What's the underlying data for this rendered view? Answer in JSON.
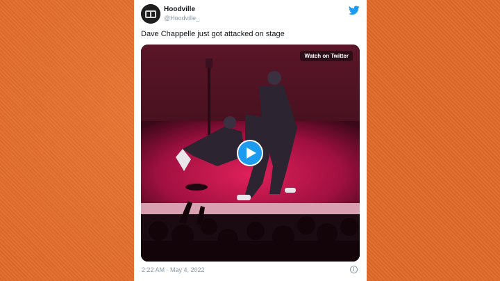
{
  "tweet": {
    "author_name": "Hoodville",
    "author_handle": "@Hoodville_",
    "text": "Dave Chappelle just got attacked on stage",
    "timestamp": "2:22 AM · May 4, 2022",
    "watch_label": "Watch on Twitter",
    "info_glyph": "i"
  },
  "colors": {
    "background": "#e06a2a",
    "card": "#ffffff",
    "twitter_blue": "#1d9bf0",
    "stage_red": "#c01848"
  },
  "icons": {
    "brand": "twitter-bird-icon",
    "play": "play-icon",
    "info": "info-icon"
  }
}
